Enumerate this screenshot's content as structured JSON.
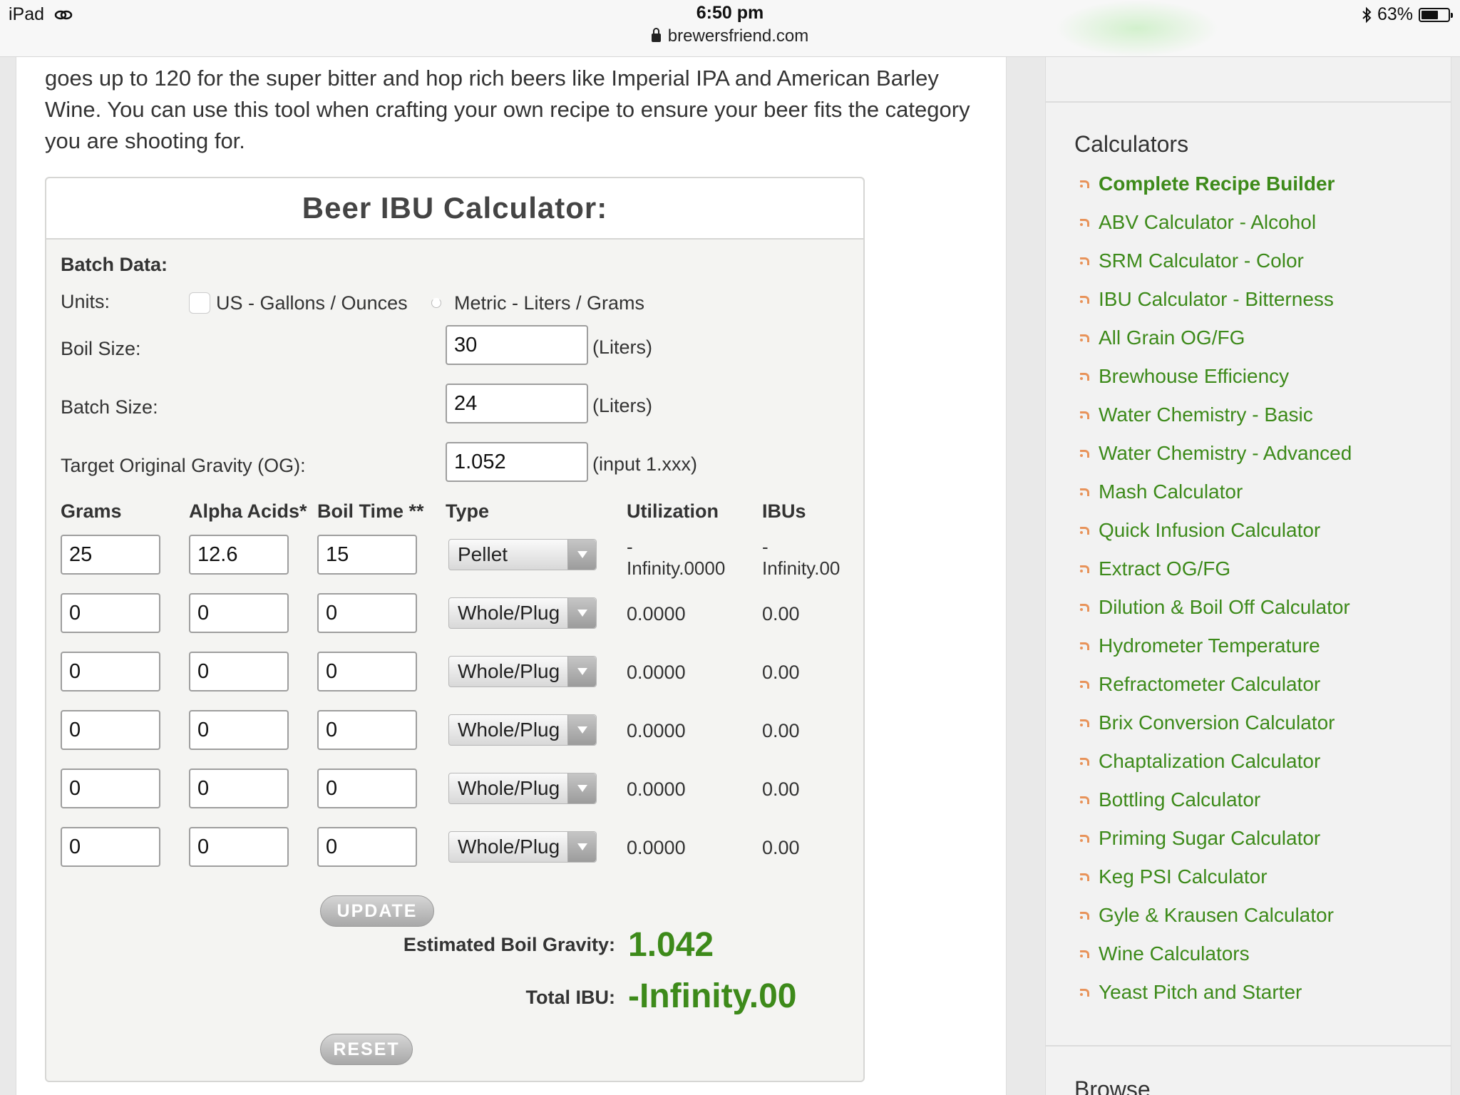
{
  "status_bar": {
    "device": "iPad",
    "time": "6:50 pm",
    "url": "brewersfriend.com",
    "battery": "63%",
    "battery_level": 0.63
  },
  "intro_text": "goes up to 120 for the super bitter and hop rich beers like Imperial IPA and American Barley Wine. You can use this tool when crafting your own recipe to ensure your beer fits the category you are shooting for.",
  "calculator": {
    "title": "Beer IBU Calculator:",
    "batch_data_label": "Batch Data:",
    "units_label": "Units:",
    "unit_us": "US - Gallons / Ounces",
    "unit_metric": "Metric - Liters / Grams",
    "boil_size_label": "Boil Size:",
    "boil_size_value": "30",
    "boil_size_unit": "(Liters)",
    "batch_size_label": "Batch Size:",
    "batch_size_value": "24",
    "batch_size_unit": "(Liters)",
    "og_label": "Target Original Gravity (OG):",
    "og_value": "1.052",
    "og_hint": "(input 1.xxx)",
    "columns": [
      "Grams",
      "Alpha Acids*",
      "Boil Time **",
      "Type",
      "Utilization",
      "IBUs"
    ],
    "rows": [
      {
        "grams": "25",
        "alpha": "12.6",
        "boil": "15",
        "type": "Pellet",
        "util_line1": "-",
        "util_line2": "Infinity.0000",
        "ibu_line1": "-",
        "ibu_line2": "Infinity.00"
      },
      {
        "grams": "0",
        "alpha": "0",
        "boil": "0",
        "type": "Whole/Plug",
        "util_line1": "",
        "util_line2": "0.0000",
        "ibu_line1": "",
        "ibu_line2": "0.00"
      },
      {
        "grams": "0",
        "alpha": "0",
        "boil": "0",
        "type": "Whole/Plug",
        "util_line1": "",
        "util_line2": "0.0000",
        "ibu_line1": "",
        "ibu_line2": "0.00"
      },
      {
        "grams": "0",
        "alpha": "0",
        "boil": "0",
        "type": "Whole/Plug",
        "util_line1": "",
        "util_line2": "0.0000",
        "ibu_line1": "",
        "ibu_line2": "0.00"
      },
      {
        "grams": "0",
        "alpha": "0",
        "boil": "0",
        "type": "Whole/Plug",
        "util_line1": "",
        "util_line2": "0.0000",
        "ibu_line1": "",
        "ibu_line2": "0.00"
      },
      {
        "grams": "0",
        "alpha": "0",
        "boil": "0",
        "type": "Whole/Plug",
        "util_line1": "",
        "util_line2": "0.0000",
        "ibu_line1": "",
        "ibu_line2": "0.00"
      }
    ],
    "update_label": "UPDATE",
    "boil_gravity_label": "Estimated Boil Gravity:",
    "boil_gravity_value": "1.042",
    "total_ibu_label": "Total IBU:",
    "total_ibu_value": "-Infinity.00",
    "reset_label": "RESET",
    "accent_color": "#3d8a1a"
  },
  "sidebar": {
    "heading": "Calculators",
    "items": [
      "Complete Recipe Builder",
      "ABV Calculator - Alcohol",
      "SRM Calculator - Color",
      "IBU Calculator - Bitterness",
      "All Grain OG/FG",
      "Brewhouse Efficiency",
      "Water Chemistry - Basic",
      "Water Chemistry - Advanced",
      "Mash Calculator",
      "Quick Infusion Calculator",
      "Extract OG/FG",
      "Dilution & Boil Off Calculator",
      "Hydrometer Temperature",
      "Refractometer Calculator",
      "Brix Conversion Calculator",
      "Chaptalization Calculator",
      "Bottling Calculator",
      "Priming Sugar Calculator",
      "Keg PSI Calculator",
      "Gyle & Krausen Calculator",
      "Wine Calculators",
      "Yeast Pitch and Starter"
    ],
    "browse_heading": "Browse",
    "link_color": "#3d8a1a",
    "bullet_icon": "arrow-bullet-icon"
  }
}
